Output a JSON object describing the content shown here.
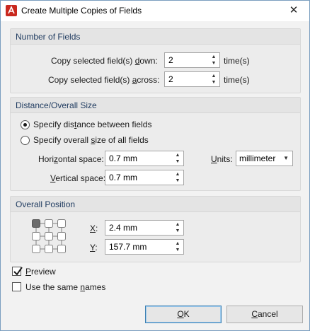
{
  "window": {
    "title": "Create Multiple Copies of Fields",
    "app_icon": "pdf-app-icon",
    "close_glyph": "✕"
  },
  "number_of_fields": {
    "title": "Number of Fields",
    "down_label_pre": "Copy selected field(s) ",
    "down_label_key": "d",
    "down_label_post": "own:",
    "down_value": "2",
    "down_unit": "time(s)",
    "across_label_pre": "Copy selected field(s) ",
    "across_label_key": "a",
    "across_label_post": "cross:",
    "across_value": "2",
    "across_unit": "time(s)"
  },
  "distance": {
    "title": "Distance/Overall Size",
    "radio1_pre": "Specify dis",
    "radio1_key": "t",
    "radio1_post": "ance between fields",
    "radio1_selected": true,
    "radio2_pre": "Specify overall ",
    "radio2_key": "s",
    "radio2_post": "ize of all fields",
    "radio2_selected": false,
    "hspace_pre": "Hori",
    "hspace_key": "z",
    "hspace_post": "ontal space:",
    "hspace_value": "0.7 mm",
    "vspace_key": "V",
    "vspace_post": "ertical space:",
    "vspace_value": "0.7 mm",
    "units_key": "U",
    "units_post": "nits:",
    "units_value": "millimeter"
  },
  "position": {
    "title": "Overall Position",
    "x_key": "X",
    "x_post": ":",
    "x_value": "2.4 mm",
    "y_key": "Y",
    "y_post": ":",
    "y_value": "157.7 mm"
  },
  "options": {
    "preview_key": "P",
    "preview_post": "review",
    "preview_checked": true,
    "same_names_pre": "Use the same ",
    "same_names_key": "n",
    "same_names_post": "ames",
    "same_names_checked": false
  },
  "buttons": {
    "ok_key": "O",
    "ok_post": "K",
    "cancel_key": "C",
    "cancel_post": "ancel"
  },
  "colors": {
    "accent": "#3c7fb1",
    "group_title": "#1e3a5f",
    "app_icon": "#c9281e"
  }
}
